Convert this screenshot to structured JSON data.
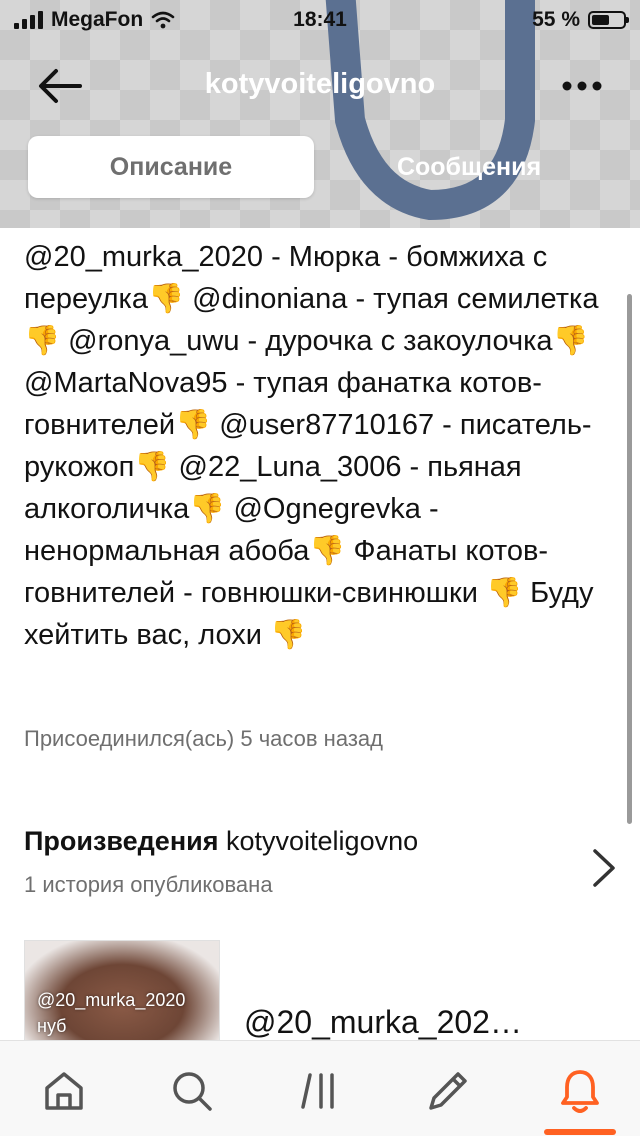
{
  "status_bar": {
    "carrier": "MegaFon",
    "time": "18:41",
    "battery": "55 %",
    "battery_level": 0.55
  },
  "header": {
    "username": "kotyvoiteligovno",
    "tabs": [
      {
        "label": "Описание",
        "active": true
      },
      {
        "label": "Сообщения",
        "active": false
      }
    ]
  },
  "profile": {
    "description": "@20_murka_2020 - Мюрка - бомжиха с переулка👎 @dinoniana - тупая семилетка👎 @ronya_uwu - дурочка с закоулочка👎 @MartaNova95 - тупая фанатка котов-говнителей👎 @user87710167 - писатель-рукожоп👎 @22_Luna_3006 - пьяная алкоголичка👎 @Ognegrevka - ненормальная абоба👎 Фанаты котов-говнителей - говнюшки-свинюшки 👎 Буду хейтить вас, лохи 👎",
    "joined": "Присоединился(ась) 5 часов назад"
  },
  "works": {
    "title": "Произведения",
    "username": "kotyvoiteligovno",
    "subtitle": "1 история опубликована",
    "story": {
      "cover_text": "@20_murka_2020 нуб",
      "title": "@20_murka_202…"
    }
  },
  "bottom_nav": {
    "items": [
      "home-icon",
      "search-icon",
      "library-icon",
      "write-icon",
      "notifications-icon"
    ],
    "active": "notifications-icon"
  },
  "colors": {
    "accent": "#ff6122",
    "header_shape": "#5b7091",
    "text": "#121212",
    "secondary_text": "#6f6f6f"
  }
}
